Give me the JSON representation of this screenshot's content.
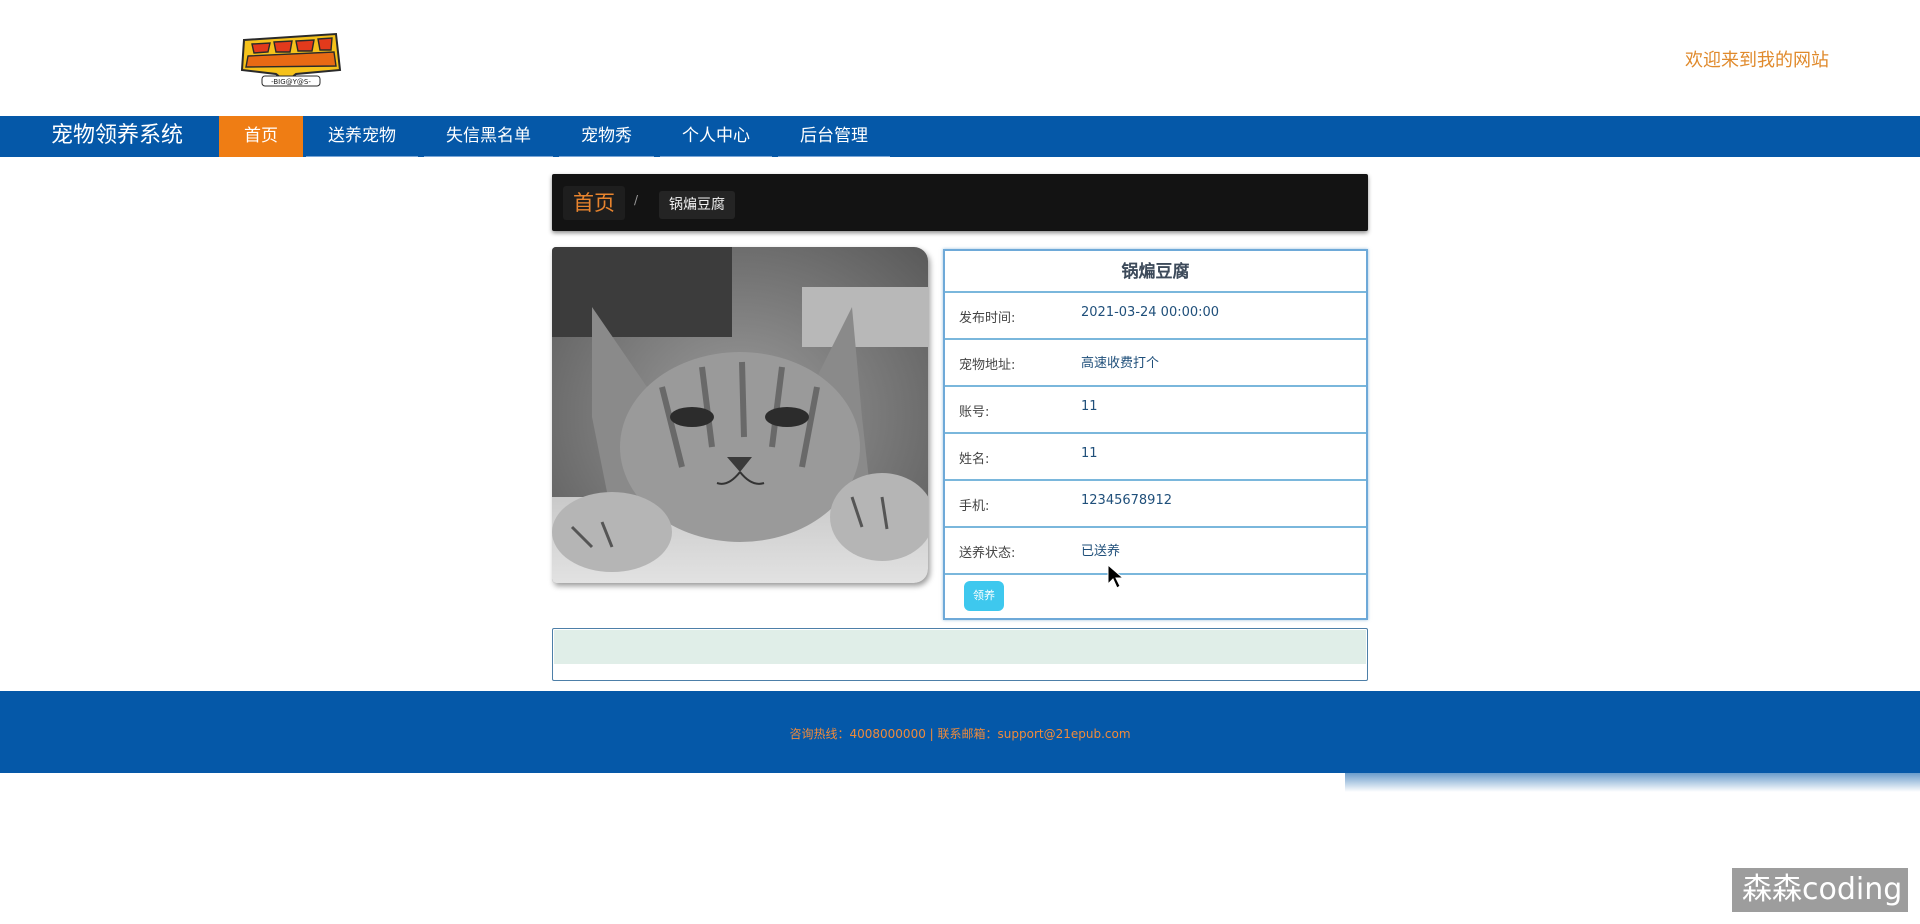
{
  "header": {
    "welcome_text": "欢迎来到我的网站"
  },
  "nav": {
    "brand": "宠物领养系统",
    "items": [
      {
        "label": "首页",
        "active": true
      },
      {
        "label": "送养宠物",
        "active": false
      },
      {
        "label": "失信黑名单",
        "active": false
      },
      {
        "label": "宠物秀",
        "active": false
      },
      {
        "label": "个人中心",
        "active": false
      },
      {
        "label": "后台管理",
        "active": false
      }
    ]
  },
  "breadcrumb": {
    "home": "首页",
    "separator": "/",
    "current": "锅煸豆腐"
  },
  "detail": {
    "title": "锅煸豆腐",
    "rows": [
      {
        "label": "发布时间:",
        "value": "2021-03-24 00:00:00"
      },
      {
        "label": "宠物地址:",
        "value": "高速收费打个"
      },
      {
        "label": "账号:",
        "value": "11"
      },
      {
        "label": "姓名:",
        "value": "11"
      },
      {
        "label": "手机:",
        "value": "12345678912"
      },
      {
        "label": "送养状态:",
        "value": "已送养"
      }
    ],
    "adopt_button": "领养"
  },
  "footer": {
    "text": "咨询热线：4008000000 | 联系邮箱：support@21epub.com"
  },
  "watermark": "森森coding",
  "colors": {
    "nav_bg": "#0558a8",
    "nav_active": "#ef7d14",
    "welcome": "#e08a2c",
    "adopt_button": "#3ec8ee"
  }
}
